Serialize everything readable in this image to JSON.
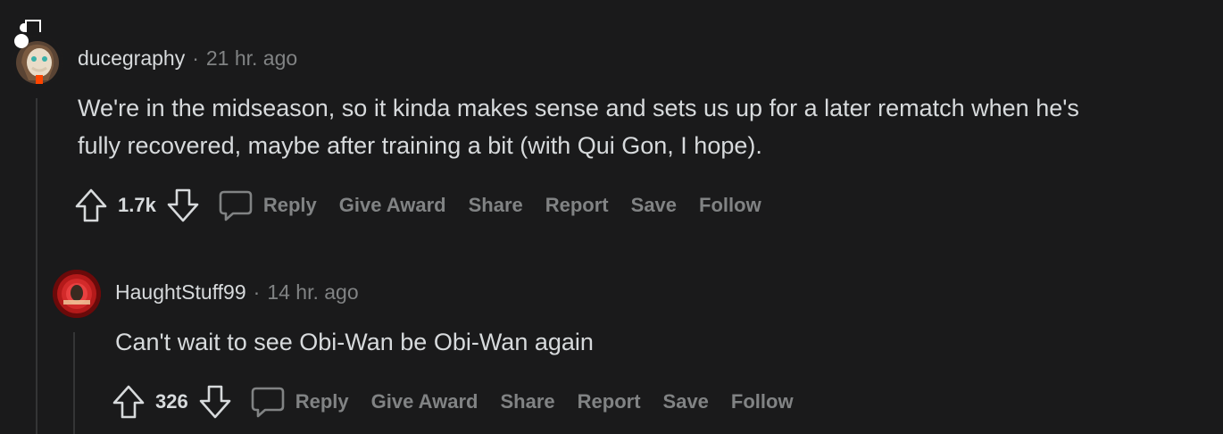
{
  "comments": [
    {
      "author": "ducegraphy",
      "separator": "·",
      "time": "21 hr. ago",
      "body_lines": [
        "We're in the midseason, so it kinda makes sense and sets us up for a later rematch when he's",
        "fully recovered, maybe after training a bit (with Qui Gon, I hope)."
      ],
      "score": "1.7k",
      "actions": {
        "reply": "Reply",
        "award": "Give Award",
        "share": "Share",
        "report": "Report",
        "save": "Save",
        "follow": "Follow"
      }
    },
    {
      "author": "HaughtStuff99",
      "separator": "·",
      "time": "14 hr. ago",
      "body_lines": [
        "Can't wait to see Obi-Wan be Obi-Wan again"
      ],
      "score": "326",
      "actions": {
        "reply": "Reply",
        "award": "Give Award",
        "share": "Share",
        "report": "Report",
        "save": "Save",
        "follow": "Follow"
      }
    }
  ],
  "colors": {
    "background": "#1a1a1b",
    "text": "#d7dadc",
    "muted": "#818384",
    "thread_line": "#343536"
  },
  "icons": [
    "upvote-icon",
    "downvote-icon",
    "comment-icon"
  ]
}
